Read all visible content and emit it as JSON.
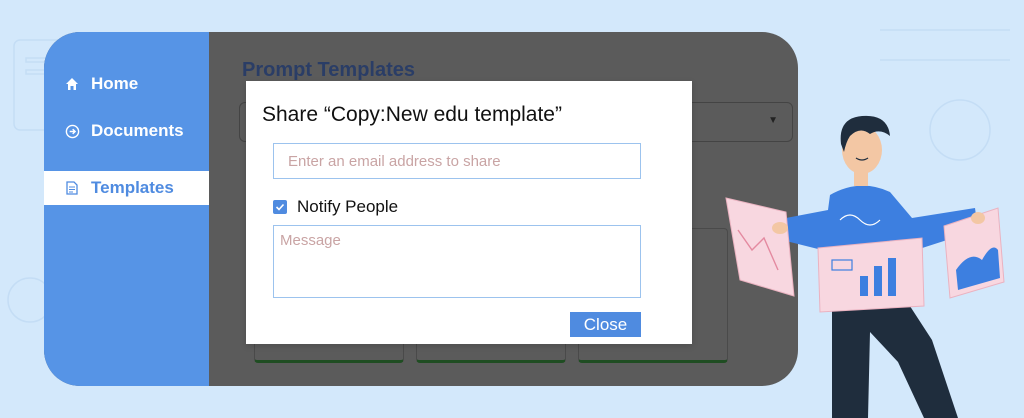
{
  "sidebar": {
    "items": [
      {
        "label": "Home",
        "icon": "home-icon",
        "active": false
      },
      {
        "label": "Documents",
        "icon": "arrow-circle-icon",
        "active": false
      },
      {
        "label": "Templates",
        "icon": "document-icon",
        "active": true
      }
    ]
  },
  "main": {
    "page_title": "Prompt Templates"
  },
  "modal": {
    "title": "Share “Copy:New edu template”",
    "email_placeholder": "Enter an email address to share",
    "notify_label": "Notify People",
    "notify_checked": true,
    "message_placeholder": "Message",
    "close_label": "Close"
  },
  "colors": {
    "page_background": "#d3e8fb",
    "sidebar": "#5694e6",
    "accent": "#4f8be0",
    "overlay": "#5b5b5b",
    "input_border": "#9cc3ee"
  }
}
